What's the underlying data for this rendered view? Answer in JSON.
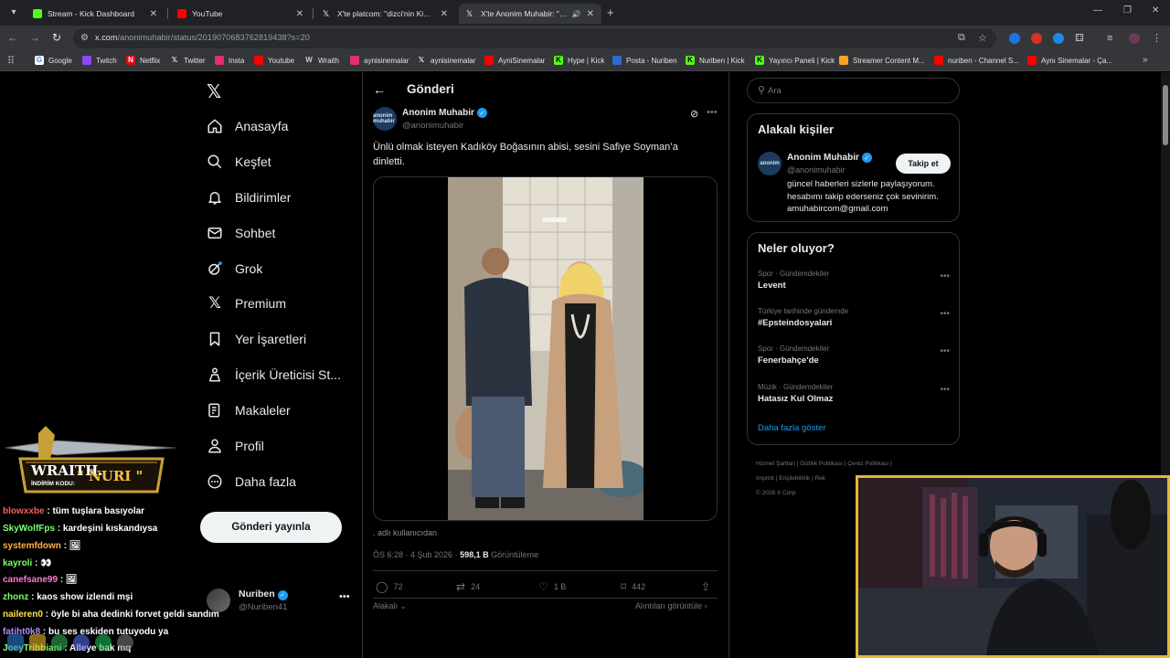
{
  "browser": {
    "tabs": [
      {
        "title": "Stream - Kick Dashboard",
        "favicon_color": "#53fc18",
        "active": false
      },
      {
        "title": "YouTube",
        "favicon_color": "#ff0000",
        "active": false
      },
      {
        "title": "X'te platcom: \"dizci'nin Kick ca",
        "favicon_color": "#ffffff",
        "active": false
      },
      {
        "title": "X'te Anonim Muhabir: \"Ünlü",
        "favicon_color": "#ffffff",
        "active": true
      }
    ],
    "url_host": "x.com",
    "url_path": "/anonimuhabir/status/2019070683762819438?s=20",
    "bookmarks": [
      {
        "label": "Google",
        "icon": "google-icon",
        "color": "#4285f4"
      },
      {
        "label": "Twitch",
        "icon": "twitch-icon",
        "color": "#9146ff"
      },
      {
        "label": "Netflix",
        "icon": "netflix-icon",
        "color": "#e50914"
      },
      {
        "label": "Twitter",
        "icon": "x-icon",
        "color": "#000000"
      },
      {
        "label": "Insta",
        "icon": "instagram-icon",
        "color": "#e1306c"
      },
      {
        "label": "Youtube",
        "icon": "youtube-icon",
        "color": "#ff0000"
      },
      {
        "label": "Wraith",
        "icon": "wraith-icon",
        "color": "#555555"
      },
      {
        "label": "aynisinemalar",
        "icon": "instagram-icon",
        "color": "#e1306c"
      },
      {
        "label": "aynisinemalar",
        "icon": "x-icon",
        "color": "#000000"
      },
      {
        "label": "AyniSinemalar",
        "icon": "youtube-icon",
        "color": "#ff0000"
      },
      {
        "label": "Hype | Kick",
        "icon": "kick-icon",
        "color": "#53fc18"
      },
      {
        "label": "Posta - Nuriben",
        "icon": "posta-icon",
        "color": "#2b6cd4"
      },
      {
        "label": "Nuriben | Kick",
        "icon": "kick-icon",
        "color": "#53fc18"
      },
      {
        "label": "Yayıncı Paneli | Kick",
        "icon": "kick-icon",
        "color": "#53fc18"
      },
      {
        "label": "Streamer Content M...",
        "icon": "streamer-icon",
        "color": "#f5a623"
      },
      {
        "label": "nuriben - Channel S...",
        "icon": "youtube-studio-icon",
        "color": "#ff0000"
      },
      {
        "label": "Aynı Sinemalar - Ça...",
        "icon": "youtube-icon",
        "color": "#ff0000"
      }
    ]
  },
  "sidebar": {
    "items": [
      {
        "label": "Anasayfa",
        "icon": "home-icon"
      },
      {
        "label": "Keşfet",
        "icon": "search-icon"
      },
      {
        "label": "Bildirimler",
        "icon": "bell-icon"
      },
      {
        "label": "Sohbet",
        "icon": "mail-icon"
      },
      {
        "label": "Grok",
        "icon": "grok-icon"
      },
      {
        "label": "Premium",
        "icon": "x-icon"
      },
      {
        "label": "Yer İşaretleri",
        "icon": "bookmark-icon"
      },
      {
        "label": "İçerik Üreticisi St...",
        "icon": "creator-icon"
      },
      {
        "label": "Makaleler",
        "icon": "article-icon"
      },
      {
        "label": "Profil",
        "icon": "person-icon"
      },
      {
        "label": "Daha fazla",
        "icon": "more-circle-icon"
      }
    ],
    "post_button": "Gönderi yayınla",
    "account": {
      "name": "Nuriben",
      "handle": "@Nuriben41"
    }
  },
  "post": {
    "header": "Gönderi",
    "author_name": "Anonim Muhabir",
    "author_handle": "@anonimuhabir",
    "avatar_text": "anonim muhabir",
    "text": "Ünlü olmak isteyen Kadıköy Boğasının abisi, sesini Safiye Soyman’a dinletti.",
    "source": ". adlı kullanıcıdan",
    "time": "ÖS 6:28 · 4 Şub 2026 · ",
    "views": "598,1 B",
    "views_label": " Görüntüleme",
    "stats": {
      "replies": "72",
      "reposts": "24",
      "likes": "1 B",
      "bookmarks": "442"
    },
    "reply_sort": "Alakalı",
    "quotes_link": "Alıntıları görüntüle"
  },
  "right": {
    "search_placeholder": "Ara",
    "relevant_title": "Alakalı kişiler",
    "relevant_person": {
      "name": "Anonim Muhabir",
      "handle": "@anonimuhabir",
      "follow": "Takip et",
      "bio": "güncel haberleri sizlerle paylaşıyorum. hesabımı takip ederseniz çok sevinirim. amuhabircom@gmail.com"
    },
    "trends_title": "Neler oluyor?",
    "trends": [
      {
        "category": "Spor · Gündemdekiler",
        "title": "Levent"
      },
      {
        "category": "Türkiye tarihinde gündemde",
        "title": "#Epsteindosyalari"
      },
      {
        "category": "Spor · Gündemdekiler",
        "title": "Fenerbahçe'de"
      },
      {
        "category": "Müzik · Gündemdekiler",
        "title": "Hatasız Kul Olmaz"
      }
    ],
    "show_more": "Daha fazla göster",
    "footer_links": [
      "Hizmet Şartları",
      "Gizlilik Politikası",
      "Çerez Politikası",
      "Imprint",
      "Erişilebilirlik",
      "Rek"
    ],
    "copyright": "© 2026 X Corp."
  },
  "overlay": {
    "sponsor_name": "WRAITH.",
    "sponsor_code_label": "İNDİRİM KODU:",
    "sponsor_code": "\" NURI \"",
    "chat": [
      {
        "user": "blowxxbe",
        "msg": ": tüm tuşlara basıyolar",
        "color": "#ff5a5a"
      },
      {
        "user": "SkyWolfFps",
        "msg": ": kardeşini kıskandıysa",
        "color": "#7cff6b"
      },
      {
        "user": "systemfdown",
        "msg": ": 🖼",
        "color": "#ffb347"
      },
      {
        "user": "kayroli",
        "msg": ": 👀",
        "color": "#7cff6b"
      },
      {
        "user": "canefsane99",
        "msg": ": 🖼",
        "color": "#ff7ad9"
      },
      {
        "user": "zhonz",
        "msg": ": kaos show izlendi mşi",
        "color": "#7cff6b"
      },
      {
        "user": "naileren0",
        "msg": ": öyle bi aha dedinki forvet geldi sandım",
        "color": "#ffe14d"
      },
      {
        "user": "fatiht0k8",
        "msg": ": bu ses eskiden tutuyodu ya",
        "color": "#b18cff"
      },
      {
        "user": "JoeyTribbiani",
        "msg": ": Alleye bak mq",
        "color": "#7cff6b"
      }
    ]
  }
}
